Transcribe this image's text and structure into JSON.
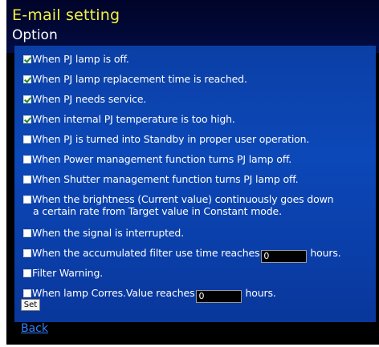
{
  "header": {
    "title": "E-mail setting",
    "subtitle": "Option"
  },
  "options": [
    {
      "label": "When PJ lamp is off.",
      "checked": true
    },
    {
      "label": "When PJ lamp replacement time is reached.",
      "checked": true
    },
    {
      "label": "When PJ needs service.",
      "checked": true
    },
    {
      "label": "When internal PJ temperature is too high.",
      "checked": true
    },
    {
      "label": "When PJ is turned into Standby in proper user operation.",
      "checked": false
    },
    {
      "label": "When Power management function turns PJ lamp off.",
      "checked": false
    },
    {
      "label": "When Shutter management function turns PJ lamp off.",
      "checked": false
    },
    {
      "label": "When the brightness (Current value) continuously goes down",
      "label_line2": "a certain rate from Target value in Constant mode.",
      "checked": false
    },
    {
      "label": "When the signal is interrupted.",
      "checked": false
    },
    {
      "label": "When the accumulated filter use time reaches",
      "value": "0",
      "unit": "hours.",
      "checked": false
    },
    {
      "label": "Filter Warning.",
      "checked": false
    },
    {
      "label": "When lamp Corres.Value reaches",
      "value": "0",
      "unit": "hours.",
      "checked": false
    }
  ],
  "buttons": {
    "set_label": "Set"
  },
  "links": {
    "back_label": "Back"
  },
  "colors": {
    "title": "#f2f23a",
    "panel": "#0c48b8",
    "link": "#2f7fff",
    "check": "#1c8a1c"
  }
}
